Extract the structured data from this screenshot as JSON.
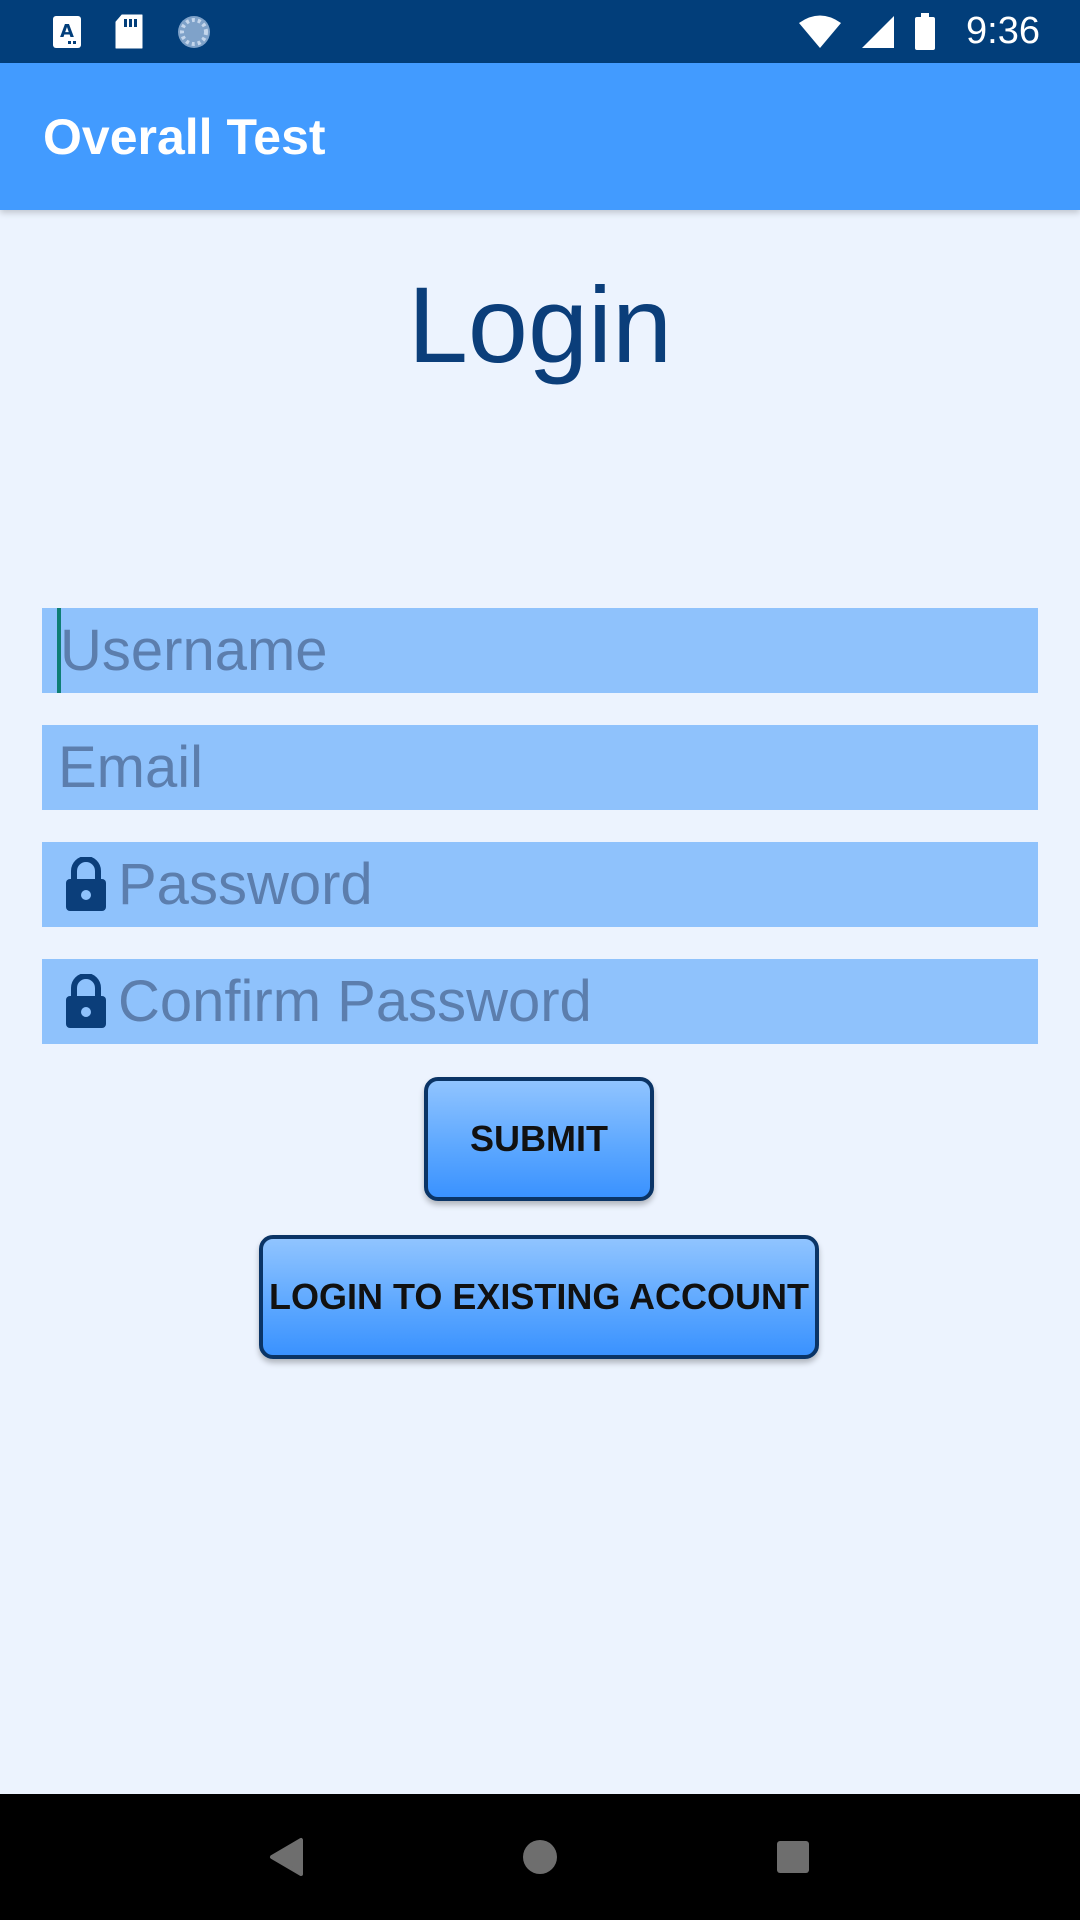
{
  "status_bar": {
    "time": "9:36",
    "icons_left": [
      "a-icon",
      "sd-card-icon",
      "loading-icon"
    ],
    "icons_right": [
      "wifi-icon",
      "cell-signal-icon",
      "battery-icon"
    ]
  },
  "app_bar": {
    "title": "Overall Test"
  },
  "heading": "Login",
  "form": {
    "username_placeholder": "Username",
    "email_placeholder": "Email",
    "password_placeholder": "Password",
    "confirm_password_placeholder": "Confirm Password"
  },
  "buttons": {
    "submit": "SUBMIT",
    "login_existing": "LOGIN TO EXISTING ACCOUNT"
  },
  "colors": {
    "status_bar": "#023E7A",
    "app_bar": "#429BFF",
    "background": "#ECF3FE",
    "field": "#8FC2FC",
    "heading": "#0B3E7A"
  }
}
